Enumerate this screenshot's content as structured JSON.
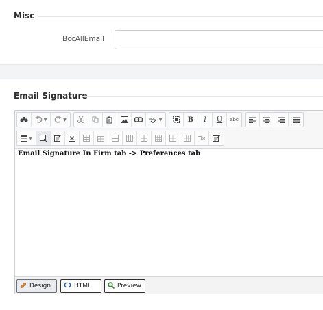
{
  "misc": {
    "title": "Misc",
    "bcc_label": "BccAllEmail",
    "bcc_value": ""
  },
  "signature": {
    "title": "Email Signature",
    "content": "Email Signature In Firm tab -> Preferences tab"
  },
  "toolbar": {
    "row1": [
      [
        "find-icon",
        "undo-icon",
        "redo-icon"
      ],
      [
        "cut-icon",
        "copy-icon",
        "paste-icon",
        "image-icon",
        "link-icon",
        "spellcheck-icon"
      ],
      [
        "select-all-icon",
        "bold-icon",
        "italic-icon",
        "underline-icon",
        "strikethrough-icon"
      ],
      [
        "align-left-icon",
        "align-center-icon",
        "align-right-icon",
        "justify-icon"
      ]
    ],
    "row2": [
      [
        "table-icon",
        "table-properties-icon",
        "cell-properties-icon",
        "delete-table-icon",
        "insert-row-above-icon",
        "insert-row-below-icon",
        "delete-row-icon",
        "insert-column-left-icon",
        "insert-column-right-icon",
        "delete-column-icon",
        "merge-cells-icon",
        "split-cell-icon",
        "delete-cell-icon",
        "form-properties-icon"
      ]
    ],
    "labels": {
      "bold": "B",
      "italic": "I",
      "underline": "U",
      "strike": "abc"
    }
  },
  "modes": {
    "design": "Design",
    "html": "HTML",
    "preview": "Preview",
    "active": "Design"
  },
  "colors": {
    "accent_border": "#6c7076",
    "section_line": "#e2e6ea",
    "page_bg": "#f3f4f6"
  }
}
